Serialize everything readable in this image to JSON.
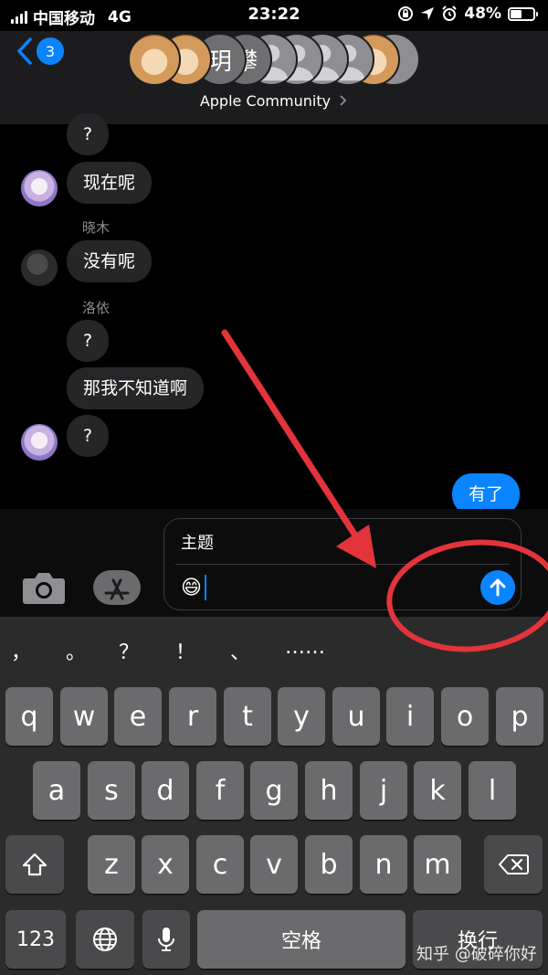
{
  "status_bar": {
    "carrier": "中国移动",
    "network": "4G",
    "time": "23:22",
    "battery_percent": "48%",
    "battery_level": 0.48
  },
  "header": {
    "back_badge": "3",
    "group_name": "Apple Community",
    "avatar_chars": [
      "玥",
      "攀"
    ]
  },
  "messages": [
    {
      "side": "in",
      "text": "?"
    },
    {
      "side": "in",
      "text": "现在呢"
    },
    {
      "side": "in",
      "sender": "晓木",
      "text": "没有呢"
    },
    {
      "side": "in",
      "sender": "洛依",
      "text": "?"
    },
    {
      "side": "in",
      "text": "那我不知道啊"
    },
    {
      "side": "in",
      "text": "?"
    },
    {
      "side": "out",
      "text": "有了"
    }
  ],
  "compose": {
    "subject": "主题",
    "body": "😄"
  },
  "keyboard": {
    "candidates": [
      "，",
      "。",
      "？",
      "！",
      "、",
      "……"
    ],
    "row1": [
      "q",
      "w",
      "e",
      "r",
      "t",
      "y",
      "u",
      "i",
      "o",
      "p"
    ],
    "row2": [
      "a",
      "s",
      "d",
      "f",
      "g",
      "h",
      "j",
      "k",
      "l"
    ],
    "row3": [
      "z",
      "x",
      "c",
      "v",
      "b",
      "n",
      "m"
    ],
    "numbers": "123",
    "space": "空格",
    "return": "换行"
  },
  "watermark": "知乎 @破碎你好",
  "colors": {
    "accent_blue": "#0a84ff",
    "annotation_red": "#e3343c",
    "bubble_incoming": "#262628"
  }
}
